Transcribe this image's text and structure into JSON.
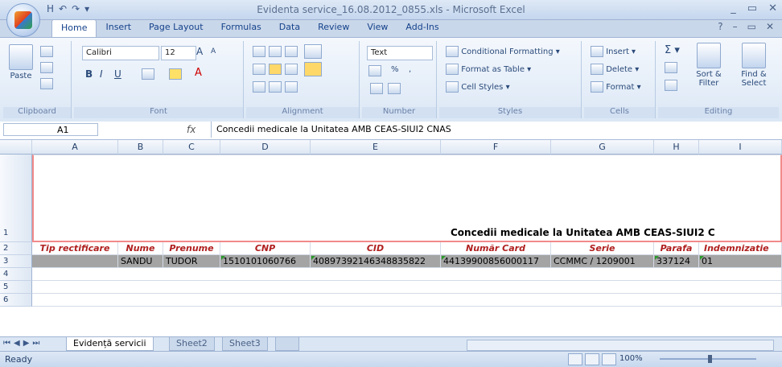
{
  "window": {
    "title": "Evidenta service_16.08.2012_0855.xls - Microsoft Excel",
    "qat": [
      "H",
      "↶",
      "↷",
      "▾"
    ],
    "controls": [
      "_",
      "▭",
      "✕"
    ]
  },
  "ribbon_tabs": [
    "Home",
    "Insert",
    "Page Layout",
    "Formulas",
    "Data",
    "Review",
    "View",
    "Add-Ins"
  ],
  "ribbon": {
    "clipboard": {
      "paste": "Paste",
      "label": "Clipboard"
    },
    "font": {
      "name": "Calibri",
      "size": "12",
      "label": "Font",
      "bold": "B",
      "italic": "I",
      "underline": "U",
      "grow": "A",
      "shrink": "A",
      "color": "A"
    },
    "alignment": {
      "label": "Alignment"
    },
    "number": {
      "format": "Text",
      "percent": "%",
      "comma": ",",
      "label": "Number"
    },
    "styles": {
      "conditional": "Conditional Formatting",
      "format_table": "Format as Table",
      "cell_styles": "Cell Styles",
      "label": "Styles"
    },
    "cells": {
      "insert": "Insert",
      "delete": "Delete",
      "format": "Format",
      "label": "Cells"
    },
    "editing": {
      "sum": "Σ",
      "sort": "Sort & Filter",
      "find": "Find & Select",
      "label": "Editing"
    }
  },
  "formula_bar": {
    "name_box": "A1",
    "fx": "fx",
    "content": "Concedii medicale la Unitatea AMB CEAS-SIUI2 CNAS"
  },
  "columns": [
    "A",
    "B",
    "C",
    "D",
    "E",
    "F",
    "G",
    "H",
    "I"
  ],
  "row_numbers": [
    "1",
    "2",
    "3",
    "4",
    "5",
    "6"
  ],
  "title_row": "Concedii medicale la Unitatea AMB CEAS-SIUI2 C",
  "header_row": [
    "Tip rectificare",
    "Nume",
    "Prenume",
    "CNP",
    "CID",
    "Număr Card",
    "Serie",
    "Parafa",
    "Indemnizatie"
  ],
  "data_row": [
    "",
    "SANDU",
    "TUDOR",
    "1510101060766",
    "40897392146348835822",
    "44139900856000117",
    "CCMMC / 1209001",
    "337124",
    "01"
  ],
  "sheet_tabs": [
    "Evidență servicii",
    "Sheet2",
    "Sheet3"
  ],
  "status": {
    "ready": "Ready",
    "zoom": "100%"
  }
}
